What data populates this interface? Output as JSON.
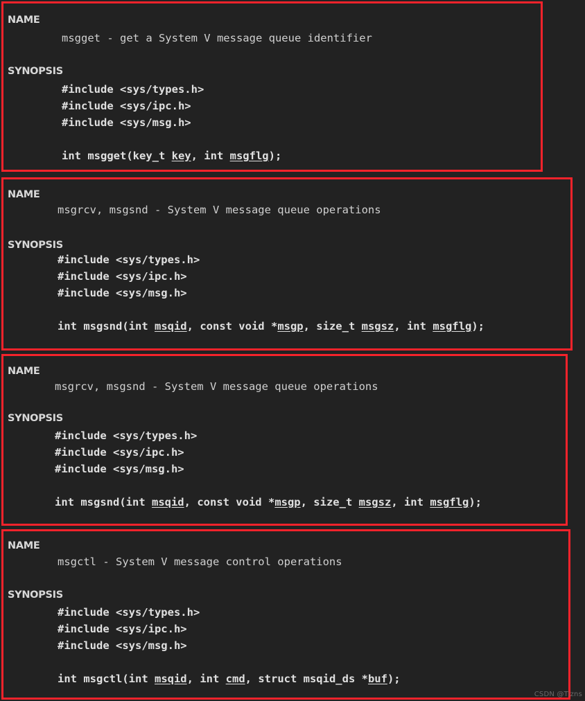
{
  "colors": {
    "background": "#222222",
    "annotation_box_border": "#f5232b",
    "text": "#d0d0d0",
    "heading_text": "#d8d8d8",
    "watermark_text": "#6a6a6a"
  },
  "watermark": "CSDN @Tizns",
  "man_pages": [
    {
      "id": "msgget",
      "name_heading": "NAME",
      "name_body": "msgget - get a System V message queue identifier",
      "synopsis_heading": "SYNOPSIS",
      "includes": [
        "#include <sys/types.h>",
        "#include <sys/ipc.h>",
        "#include <sys/msg.h>"
      ],
      "prototype_parts": [
        {
          "text": "int msgget(key_t ",
          "italic": false
        },
        {
          "text": "key",
          "italic": true
        },
        {
          "text": ", int ",
          "italic": false
        },
        {
          "text": "msgflg",
          "italic": true
        },
        {
          "text": ");",
          "italic": false
        }
      ]
    },
    {
      "id": "msgsnd-1",
      "name_heading": "NAME",
      "name_body": "msgrcv, msgsnd - System V message queue operations",
      "synopsis_heading": "SYNOPSIS",
      "includes": [
        "#include <sys/types.h>",
        "#include <sys/ipc.h>",
        "#include <sys/msg.h>"
      ],
      "prototype_parts": [
        {
          "text": "int msgsnd(int ",
          "italic": false
        },
        {
          "text": "msqid",
          "italic": true
        },
        {
          "text": ", const void *",
          "italic": false
        },
        {
          "text": "msgp",
          "italic": true
        },
        {
          "text": ", size_t ",
          "italic": false
        },
        {
          "text": "msgsz",
          "italic": true
        },
        {
          "text": ", int ",
          "italic": false
        },
        {
          "text": "msgflg",
          "italic": true
        },
        {
          "text": ");",
          "italic": false
        }
      ]
    },
    {
      "id": "msgsnd-2",
      "name_heading": "NAME",
      "name_body": "msgrcv, msgsnd - System V message queue operations",
      "synopsis_heading": "SYNOPSIS",
      "includes": [
        "#include <sys/types.h>",
        "#include <sys/ipc.h>",
        "#include <sys/msg.h>"
      ],
      "prototype_parts": [
        {
          "text": "int msgsnd(int ",
          "italic": false
        },
        {
          "text": "msqid",
          "italic": true
        },
        {
          "text": ", const void *",
          "italic": false
        },
        {
          "text": "msgp",
          "italic": true
        },
        {
          "text": ", size_t ",
          "italic": false
        },
        {
          "text": "msgsz",
          "italic": true
        },
        {
          "text": ", int ",
          "italic": false
        },
        {
          "text": "msgflg",
          "italic": true
        },
        {
          "text": ");",
          "italic": false
        }
      ]
    },
    {
      "id": "msgctl",
      "name_heading": "NAME",
      "name_body": "msgctl - System V message control operations",
      "synopsis_heading": "SYNOPSIS",
      "includes": [
        "#include <sys/types.h>",
        "#include <sys/ipc.h>",
        "#include <sys/msg.h>"
      ],
      "prototype_parts": [
        {
          "text": "int msgctl(int ",
          "italic": false
        },
        {
          "text": "msqid",
          "italic": true
        },
        {
          "text": ", int ",
          "italic": false
        },
        {
          "text": "cmd",
          "italic": true
        },
        {
          "text": ", struct msqid_ds *",
          "italic": false
        },
        {
          "text": "buf",
          "italic": true
        },
        {
          "text": ");",
          "italic": false
        }
      ]
    }
  ]
}
